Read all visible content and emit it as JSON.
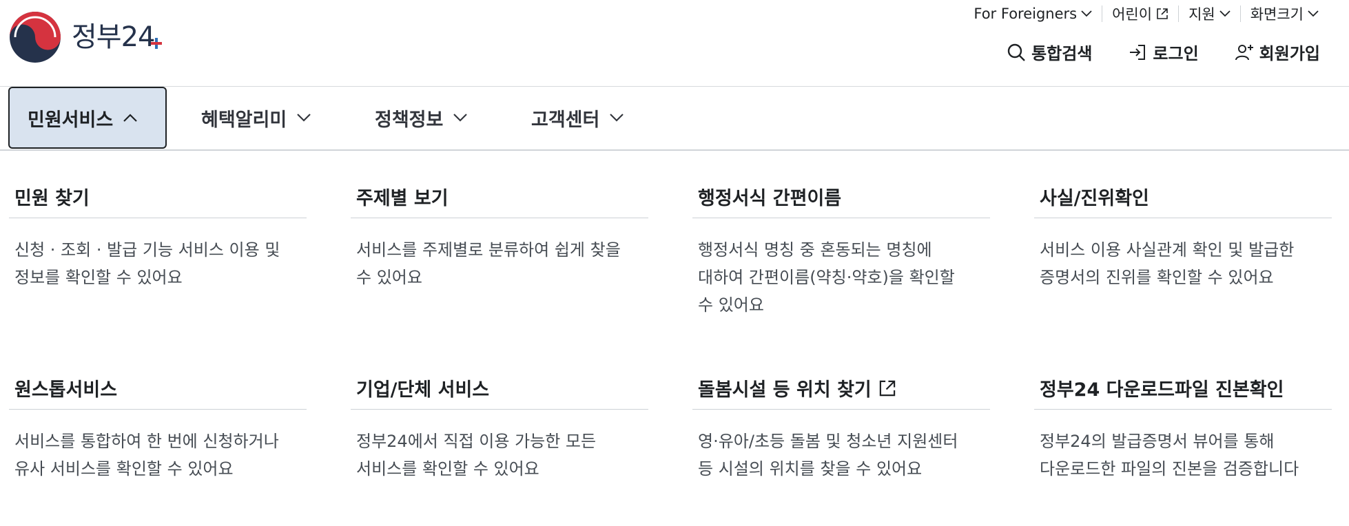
{
  "logo": {
    "text": "정부",
    "number": "24"
  },
  "utility": [
    {
      "label": "For Foreigners",
      "icon": "chevron-down-icon"
    },
    {
      "label": "어린이",
      "icon": "external-link-icon"
    },
    {
      "label": "지원",
      "icon": "chevron-down-icon"
    },
    {
      "label": "화면크기",
      "icon": "chevron-down-icon"
    }
  ],
  "actions": {
    "search": "통합검색",
    "login": "로그인",
    "signup": "회원가입"
  },
  "gnb": [
    {
      "label": "민원서비스",
      "expanded": true
    },
    {
      "label": "혜택알리미",
      "expanded": false
    },
    {
      "label": "정책정보",
      "expanded": false
    },
    {
      "label": "고객센터",
      "expanded": false
    }
  ],
  "menu": [
    {
      "title": "민원 찾기",
      "desc": "신청 · 조회 · 발급 기능 서비스 이용 및\n정보를 확인할 수 있어요"
    },
    {
      "title": "주제별 보기",
      "desc": "서비스를 주제별로 분류하여 쉽게 찾을\n수 있어요"
    },
    {
      "title": "행정서식 간편이름",
      "desc": "행정서식 명칭 중 혼동되는 명칭에\n대하여 간편이름(약칭·약호)을 확인할\n수 있어요"
    },
    {
      "title": "사실/진위확인",
      "desc": "서비스 이용 사실관계 확인 및 발급한\n증명서의 진위를 확인할 수 있어요"
    },
    {
      "title": "원스톱서비스",
      "desc": "서비스를 통합하여 한 번에 신청하거나\n유사 서비스를 확인할 수 있어요"
    },
    {
      "title": "기업/단체 서비스",
      "desc": "정부24에서 직접 이용 가능한 모든\n서비스를 확인할 수 있어요"
    },
    {
      "title": "돌봄시설 등 위치 찾기",
      "desc": "영·유아/초등 돌봄 및 청소년 지원센터\n등 시설의 위치를 찾을 수 있어요",
      "external": true
    },
    {
      "title": "정부24 다운로드파일 진본확인",
      "desc": "정부24의 발급증명서 뷰어를 통해\n다운로드한 파일의 진본을 검증합니다"
    }
  ],
  "colors": {
    "brand_navy": "#25324b",
    "active_tab_bg": "#d9e3ef",
    "accent_red": "#d5333f",
    "accent_blue": "#2f6fb5"
  }
}
